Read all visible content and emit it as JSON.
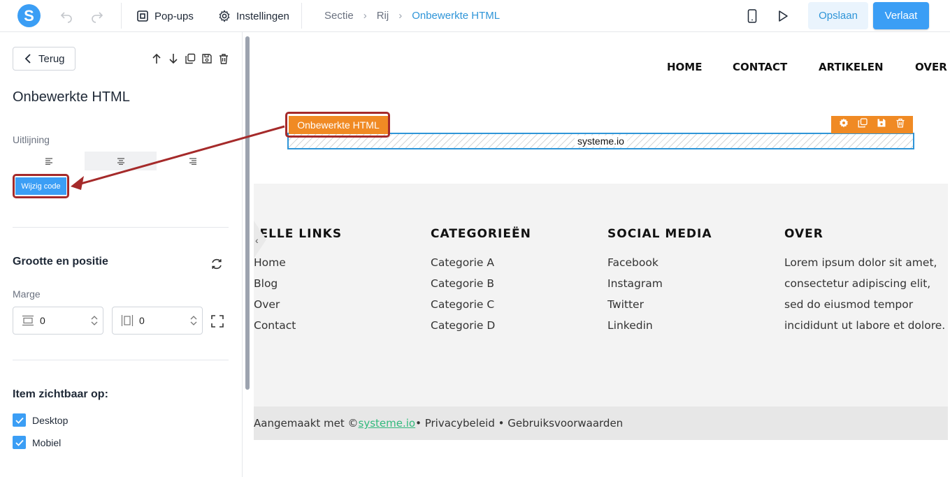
{
  "topbar": {
    "logo_letter": "S",
    "popups_label": "Pop-ups",
    "settings_label": "Instellingen",
    "breadcrumb": [
      "Sectie",
      "Rij",
      "Onbewerkte HTML"
    ],
    "save_label": "Opslaan",
    "leave_label": "Verlaat"
  },
  "sidebar": {
    "back_label": "Terug",
    "title": "Onbewerkte HTML",
    "alignment_label": "Uitlijning",
    "edit_code_label": "Wijzig code",
    "size_position_title": "Grootte en positie",
    "margin_label": "Marge",
    "margin_vertical": "0",
    "margin_horizontal": "0",
    "visible_title": "Item zichtbaar op:",
    "visible_options": [
      {
        "label": "Desktop",
        "checked": true
      },
      {
        "label": "Mobiel",
        "checked": true
      }
    ]
  },
  "canvas": {
    "nav": [
      "HOME",
      "CONTACT",
      "ARTIKELEN",
      "OVER"
    ],
    "html_tag": "Onbewerkte HTML",
    "html_content": "systeme.io",
    "footer": {
      "columns": [
        {
          "title": "SNELLE LINKS",
          "items": [
            "Home",
            "Blog",
            "Over",
            "Contact"
          ]
        },
        {
          "title": "CATEGORIEËN",
          "items": [
            "Categorie A",
            "Categorie B",
            "Categorie C",
            "Categorie D"
          ]
        },
        {
          "title": "SOCIAL MEDIA",
          "items": [
            "Facebook",
            "Instagram",
            "Twitter",
            "Linkedin"
          ]
        },
        {
          "title": "OVER",
          "text": "Lorem ipsum dolor sit amet, consectetur adipiscing elit, sed do eiusmod tempor incididunt ut labore et dolore."
        }
      ],
      "copyright_prefix": "Aangemaakt met ©",
      "copyright_link": "systeme.io",
      "copyright_suffix": "• Privacybeleid • Gebruiksvoorwaarden"
    }
  },
  "colors": {
    "accent": "#3b9ef5",
    "breadcrumb_active": "#2f95d8",
    "element_tag": "#f08a24",
    "annotation": "#a52a2a",
    "footer_link": "#31b97c"
  }
}
